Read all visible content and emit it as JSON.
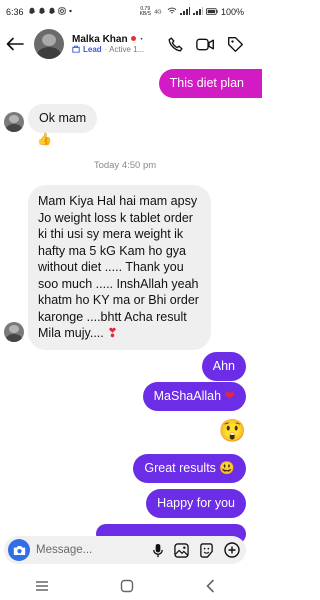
{
  "status_bar": {
    "time": "6:36",
    "network_top": "0.79",
    "network_bottom": "KB/S",
    "battery": "100%"
  },
  "header": {
    "contact_name": "Malka Khan",
    "lead_label": "Lead",
    "status": "· Active 1..."
  },
  "messages": {
    "m1": "This diet plan",
    "m2": "Ok mam",
    "m2_reaction": "👍",
    "timestamp": "Today 4:50 pm",
    "m3": "Mam Kiya Hal hai mam apsy Jo weight loss k tablet order ki thi usi sy mera weight ik hafty ma 5 kG Kam ho gya without diet ..... Thank you soo much ..... InshAllah yeah khatm ho KY ma or Bhi order karonge ....bhtt Acha result Mila mujy....",
    "m3_heart": "❣",
    "m4": "Ahn",
    "m5": "MaShaAllah",
    "m5_heart": "❤",
    "m6_emoji": "😲",
    "m7": "Great results",
    "m7_emoji": "😃",
    "m8": "Happy for you"
  },
  "composer": {
    "placeholder": "Message..."
  },
  "colors": {
    "outgoing": "#6b2de6",
    "outgoing_top": "#d21bc4",
    "incoming": "#efefef",
    "camera": "#2f6fe8"
  }
}
